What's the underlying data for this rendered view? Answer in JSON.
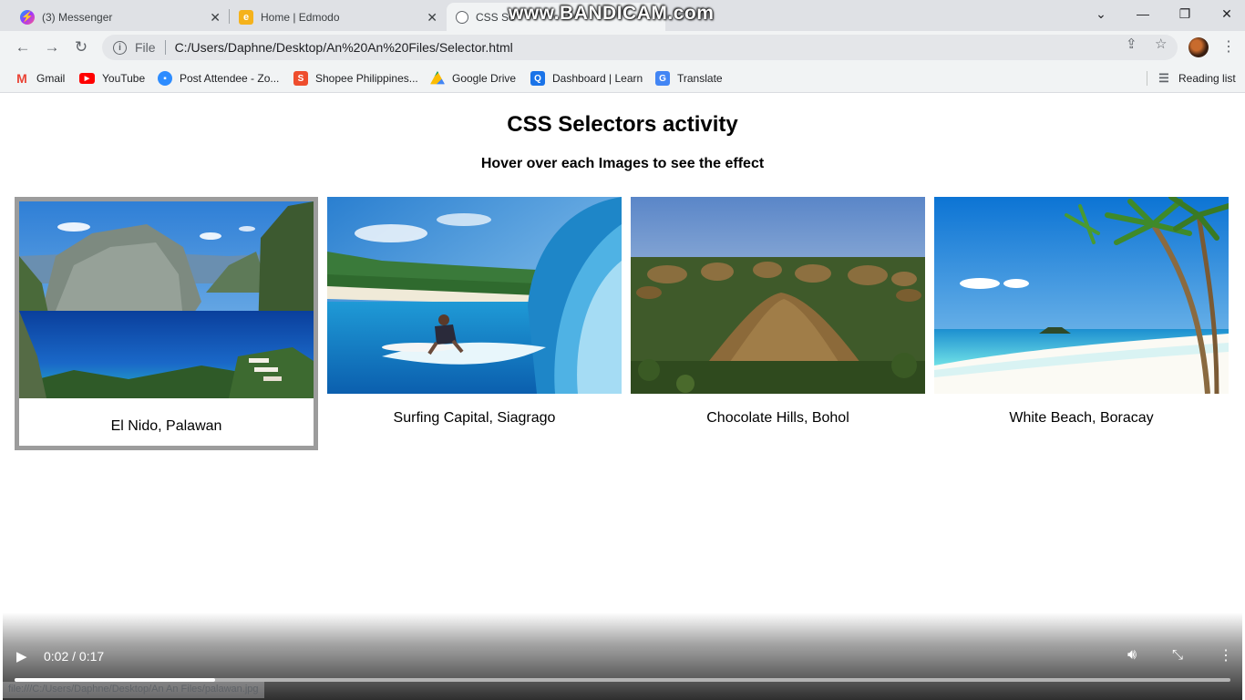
{
  "browser": {
    "tabs": [
      {
        "title": "(3) Messenger",
        "icon": "messenger-icon",
        "active": false
      },
      {
        "title": "Home | Edmodo",
        "icon": "edmodo-icon",
        "active": false
      },
      {
        "title": "CSS Se",
        "icon": "globe-icon",
        "active": true
      }
    ],
    "watermark": "www.BANDICAM.com",
    "address": {
      "scheme": "File",
      "url": "C:/Users/Daphne/Desktop/An%20An%20Files/Selector.html"
    },
    "bookmarks": [
      {
        "label": "Gmail",
        "icon": "gmail-icon",
        "color": "#ea4335"
      },
      {
        "label": "YouTube",
        "icon": "youtube-icon",
        "color": "#ff0000"
      },
      {
        "label": "Post Attendee - Zo...",
        "icon": "zoom-icon",
        "color": "#2d8cff"
      },
      {
        "label": "Shopee Philippines...",
        "icon": "shopee-icon",
        "color": "#ee4d2d"
      },
      {
        "label": "Google Drive",
        "icon": "drive-icon",
        "color": "#fbbc04"
      },
      {
        "label": "Dashboard | Learn",
        "icon": "learn-icon",
        "color": "#1a73e8"
      },
      {
        "label": "Translate",
        "icon": "translate-icon",
        "color": "#4285f4"
      }
    ],
    "reading_list": "Reading list"
  },
  "page": {
    "title": "CSS Selectors activity",
    "subtitle": "Hover over each Images to see the effect",
    "cards": [
      {
        "caption": "El Nido, Palawan",
        "hovered": true
      },
      {
        "caption": "Surfing Capital, Siagrago",
        "hovered": false
      },
      {
        "caption": "Chocolate Hills, Bohol",
        "hovered": false
      },
      {
        "caption": "White Beach, Boracay",
        "hovered": false
      }
    ]
  },
  "video": {
    "time": "0:02 / 0:17",
    "progress": 0.165,
    "status_url": "file:///C:/Users/Daphne/Desktop/An An Files/palawan.jpg"
  }
}
